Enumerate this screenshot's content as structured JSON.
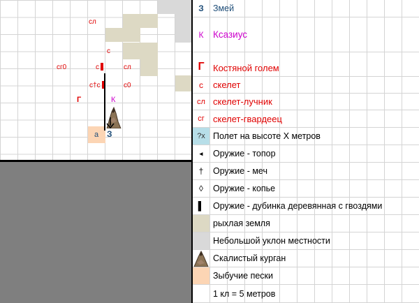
{
  "colors": {
    "zmei": "#1f4e79",
    "ksazius": "#cc00cc",
    "red": "#e00000",
    "loose_earth": "#ddd9c4",
    "slope": "#d9d9d9",
    "quicksand": "#fcd5b4",
    "flight": "#b7dee8"
  },
  "map": {
    "labels": {
      "sl1": "сл",
      "s1": "с",
      "sg1": "сг0",
      "s2": "с",
      "sl2": "сл",
      "cs": "с†с",
      "s0": "с0",
      "g": "Г",
      "k": "К",
      "a": "а",
      "z": "З"
    }
  },
  "legend": {
    "rows": [
      {
        "symbol": "З",
        "text": "Змей"
      },
      {
        "symbol": "К",
        "text": "Ксазиус"
      },
      {
        "symbol": "Г",
        "text": "Костяной голем"
      },
      {
        "symbol": "с",
        "text": "скелет"
      },
      {
        "symbol": "сл",
        "text": "скелет-лучник"
      },
      {
        "symbol": "сг",
        "text": "скелет-гвардеец"
      },
      {
        "symbol": "?x",
        "text": "Полет на высоте Х метров"
      },
      {
        "symbol": "◂",
        "text": "Оружие - топор"
      },
      {
        "symbol": "†",
        "text": "Оружие - меч"
      },
      {
        "symbol": "◊",
        "text": "Оружие - копье"
      },
      {
        "symbol": "▌",
        "text": "Оружие - дубинка деревянная с гвоздями"
      },
      {
        "symbol": "",
        "text": "рыхлая земля"
      },
      {
        "symbol": "",
        "text": "Небольшой уклон местности"
      },
      {
        "symbol": "",
        "text": "Скалистый курган"
      },
      {
        "symbol": "",
        "text": "Зыбучие пески"
      },
      {
        "symbol": "",
        "text": "1 кл = 5 метров"
      }
    ]
  }
}
